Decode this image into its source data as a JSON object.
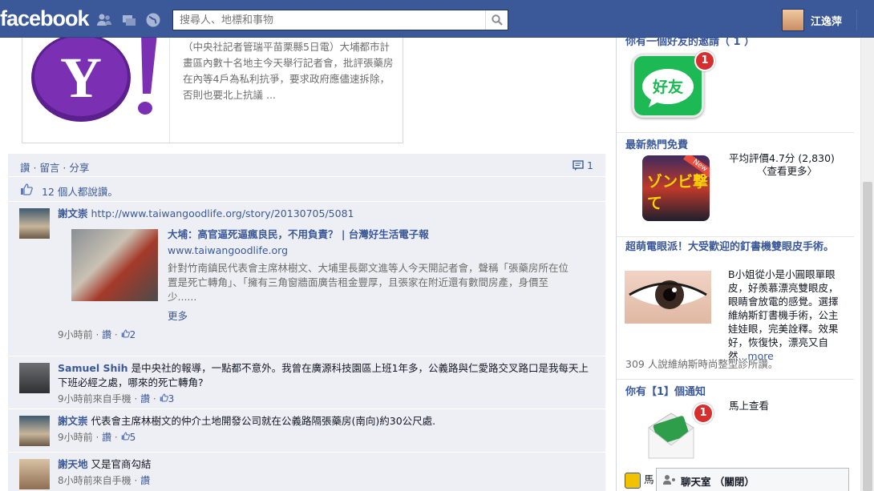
{
  "topbar": {
    "logo": "facebook",
    "search_placeholder": "搜尋人、地標和事物",
    "user_name": "江逸萍"
  },
  "feed": {
    "attachment_desc": "（中央社記者管瑞平苗栗縣5日電）大埔都市計畫區內數十名地主今天舉行記者會，批評張藥房在內等4戶為私利抗爭，要求政府應儘速拆除，否則也要北上抗議 ...",
    "actions": "讚 · 留言 · 分享",
    "comment_count": "1",
    "likes_text": "12 個人都說讚。",
    "comments": [
      {
        "author": "謝文崇",
        "text": "http://www.taiwangoodlife.org/story/20130705/5081",
        "meta_time": "9小時前",
        "meta_like": "讚",
        "meta_count": "2",
        "share": {
          "title": "大埔：高官逼死逼瘋良民，不用負責？ | 台灣好生活電子報",
          "url": "www.taiwangoodlife.org",
          "desc": "針對竹南鎮民代表會主席林樹文、大埔里長鄭文進等人今天開記者會，聲稱「張藥房所在位置是死亡轉角」、「擁有三角窗牆面廣告租金豐厚，且張家在附近還有數間房產，身價至少......",
          "more": "更多"
        }
      },
      {
        "author": "Samuel Shih",
        "text": "是中央社的報導，一點都不意外。我曾在廣源科技園區上班1年多，公義路與仁愛路交叉路口是我每天上下班必經之處，哪來的死亡轉角?",
        "meta_time": "9小時前來自手機",
        "meta_like": "讚",
        "meta_count": "3"
      },
      {
        "author": "謝文崇",
        "text": "代表會主席林樹文的仲介土地開發公司就在公義路隔張藥房(南向)約30公尺處.",
        "meta_time": "9小時前",
        "meta_like": "讚",
        "meta_count": "5"
      },
      {
        "author": "謝天地",
        "text": "又是官商勾結",
        "meta_time": "8小時前來自手機",
        "meta_like": "讚"
      }
    ]
  },
  "sidebar": {
    "invite_title": "你有一個好友的邀請（ 1 ）",
    "invite_badge": "1",
    "invite_icon_text": "好友",
    "game_title": "最新熱門免費",
    "game_rating_label": "平均評價",
    "game_rating": "4.7分 (2,830)",
    "game_more": "〈查看更多〉",
    "game_art_text": "ゾンビ撃て",
    "game_new_tag": "New",
    "ad_title": "超萌電眼派！大受歡迎的釘書機雙眼皮手術。",
    "ad_text": "B小姐從小是小圓眼單眼皮，好羨慕漂亮雙眼皮，眼睛會放電的感覺。選擇維納斯釘書機手術，公主娃娃眼，完美詮釋。效果好，恢復快，漂亮又自然",
    "ad_more": "...more",
    "ad_likes": "309 人說維納斯時尚整型診所讚。",
    "notify_title": "你有【1】個通知",
    "notify_link": "馬上查看",
    "notify_badge": "1",
    "bottom_partial": "馬",
    "chat_label": "聊天室 （關閉）"
  }
}
